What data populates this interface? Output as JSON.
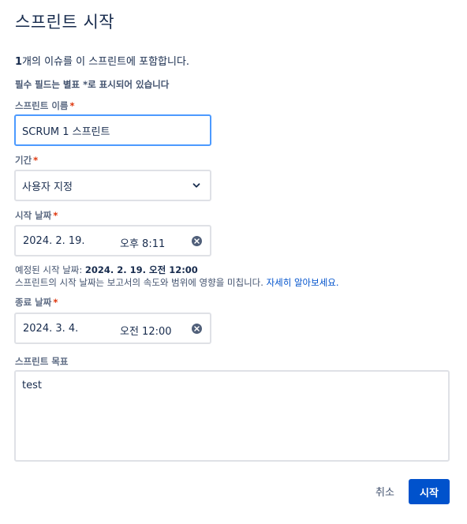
{
  "dialog": {
    "title": "스프린트 시작",
    "issue_count": "1",
    "issue_text": "개의 이슈를 이 스프린트에 포함합니다.",
    "required_note": "필수 필드는 별표 *로 표시되어 있습니다"
  },
  "fields": {
    "sprint_name": {
      "label": "스프린트 이름",
      "required_mark": "*",
      "value": "SCRUM 1 스프린트"
    },
    "duration": {
      "label": "기간",
      "required_mark": "*",
      "value": "사용자 지정"
    },
    "start_date": {
      "label": "시작 날짜",
      "required_mark": "*",
      "date": "2024. 2. 19.",
      "time": "오후 8:11"
    },
    "end_date": {
      "label": "종료 날짜",
      "required_mark": "*",
      "date": "2024. 3. 4.",
      "time": "오전 12:00"
    },
    "sprint_goal": {
      "label": "스프린트 목표",
      "value": "test"
    }
  },
  "hints": {
    "planned_prefix": "예정된 시작 날짜: ",
    "planned_value": "2024. 2. 19. 오전 12:00",
    "report_text": "스프린트의 시작 날짜는 보고서의 속도와 범위에 영향을 미칩니다. ",
    "learn_more": "자세히 알아보세요."
  },
  "buttons": {
    "cancel": "취소",
    "start": "시작"
  },
  "colors": {
    "primary": "#0052cc",
    "focus_border": "#4c9aff",
    "required": "#de350b",
    "link": "#0052cc"
  },
  "icons": {
    "duration_dropdown": "chevron-down-icon",
    "clear": "clear-icon"
  }
}
